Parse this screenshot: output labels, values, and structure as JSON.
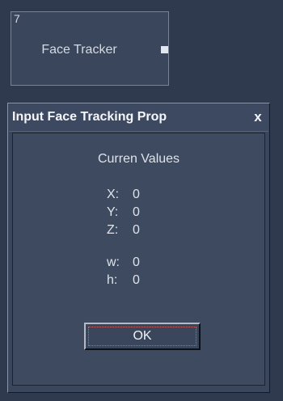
{
  "node": {
    "id": "7",
    "title": "Face Tracker"
  },
  "dialog": {
    "title": "Input Face Tracking Prop",
    "close_label": "x",
    "heading": "Curren Values",
    "values": [
      {
        "label": "X:",
        "value": "0"
      },
      {
        "label": "Y:",
        "value": "0"
      },
      {
        "label": "Z:",
        "value": "0"
      },
      {
        "label": "w:",
        "value": "0"
      },
      {
        "label": "h:",
        "value": "0"
      }
    ],
    "ok_label": "OK"
  }
}
